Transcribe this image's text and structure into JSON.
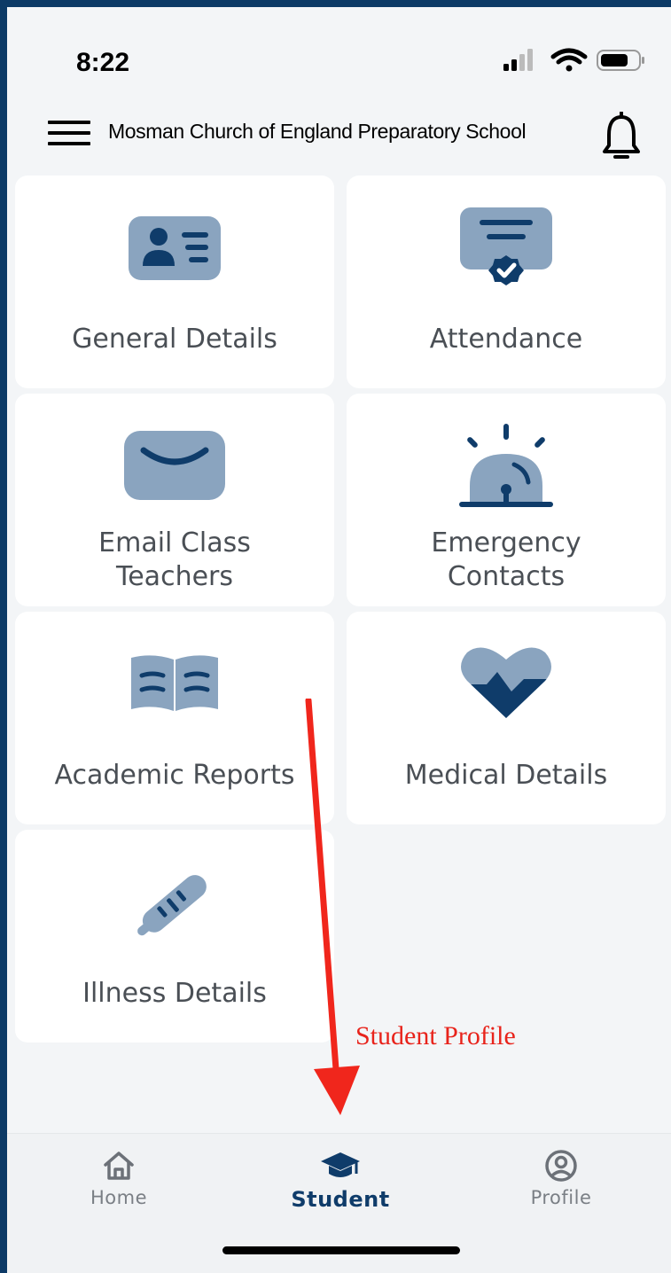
{
  "status_bar": {
    "time": "8:22",
    "icons": [
      "cellular-signal-icon",
      "wifi-icon",
      "battery-icon"
    ]
  },
  "header": {
    "title": "Mosman Church of England Preparatory School",
    "menu_icon": "hamburger-menu-icon",
    "notification_icon": "bell-icon"
  },
  "tiles": [
    {
      "label": "General Details",
      "icon": "id-card-icon"
    },
    {
      "label": "Attendance",
      "icon": "certificate-check-icon"
    },
    {
      "label": "Email Class Teachers",
      "icon": "envelope-icon"
    },
    {
      "label": "Emergency Contacts",
      "icon": "siren-icon"
    },
    {
      "label": "Academic Reports",
      "icon": "open-book-icon"
    },
    {
      "label": "Medical Details",
      "icon": "heart-pulse-icon"
    },
    {
      "label": "Illness Details",
      "icon": "thermometer-icon"
    }
  ],
  "annotation": {
    "text": "Student Profile",
    "color": "#e8231b"
  },
  "bottom_nav": [
    {
      "label": "Home",
      "icon": "home-icon",
      "active": false
    },
    {
      "label": "Student",
      "icon": "graduation-cap-icon",
      "active": true
    },
    {
      "label": "Profile",
      "icon": "user-circle-icon",
      "active": false
    }
  ],
  "colors": {
    "accent": "#0f3c6a",
    "icon_light": "#8aa4bf",
    "background": "#f3f5f7",
    "tile": "#ffffff"
  }
}
